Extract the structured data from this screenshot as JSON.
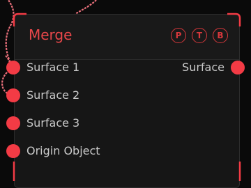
{
  "node": {
    "title": "Merge",
    "flags": [
      "P",
      "T",
      "B"
    ],
    "inputs": [
      "Surface 1",
      "Surface 2",
      "Surface 3",
      "Origin Object"
    ],
    "output": "Surface"
  },
  "colors": {
    "accent": "#e8474a",
    "port": "#f33b45",
    "wire": "#e9707b",
    "node_bg": "#161616",
    "canvas_bg": "#0a0a0a",
    "label": "#c9c9c9"
  }
}
